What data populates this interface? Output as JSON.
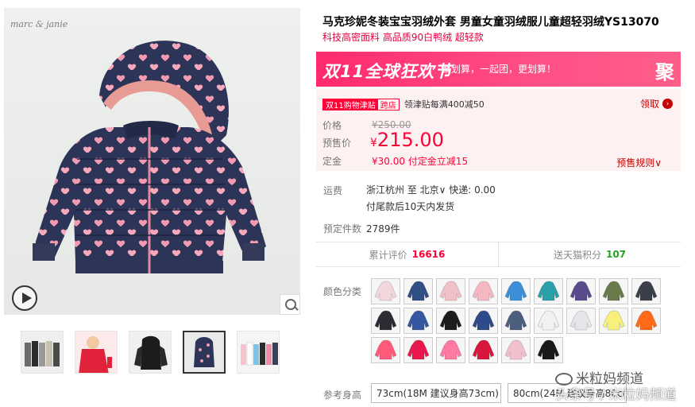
{
  "gallery": {
    "brand_logo": "marc & janie",
    "play_icon": "play-icon",
    "zoom_icon": "zoom-icon",
    "thumbnails": [
      "thumb-1",
      "thumb-2",
      "thumb-3",
      "thumb-4",
      "thumb-5"
    ],
    "active_thumbnail": 4
  },
  "product": {
    "title": "马克珍妮冬装宝宝羽绒外套 男童女童羽绒服儿童超轻羽绒YS13070",
    "subtitle": "科技高密面料 高品质90白鸭绒 超轻款"
  },
  "banner": {
    "main": "双11全球狂欢节",
    "sub": "聚划算，一起团，更划算！",
    "right": "聚"
  },
  "promo": {
    "badge_left": "双11购物津贴",
    "badge_right": "跨店",
    "text": "领津贴每满400减50",
    "get_label": "领取"
  },
  "price": {
    "price_label": "价格",
    "original": "¥250.00",
    "presale_label": "预售价",
    "currency": "¥",
    "presale": "215.00",
    "deposit_label": "定金",
    "deposit": "¥30.00  付定金立减15",
    "rules": "预售规则∨"
  },
  "shipping": {
    "label": "运费",
    "value": "浙江杭州  至  北京∨  快递: 0.00",
    "note": "付尾款后10天内发货"
  },
  "presale_count": {
    "label": "预定件数",
    "value": "2789件"
  },
  "stats": {
    "reviews_label": "累计评价",
    "reviews_value": "16616",
    "points_label": "送天猫积分",
    "points_value": "107"
  },
  "colors": {
    "label": "颜色分类",
    "swatches": [
      "#f3d7dc",
      "#2f4f86",
      "#f0c2c8",
      "#f5b8c2",
      "#3c8fd6",
      "#2aa0a8",
      "#5a4c8a",
      "#6a7a4a",
      "#3b3f4a",
      "#2c2c34",
      "#3556a0",
      "#1d1d1f",
      "#2e4a8a",
      "#4c5f7c",
      "#f1f1f1",
      "#e6e6ea",
      "#f7f07a",
      "#ff6a1a",
      "#ff5a7a",
      "#e8184e",
      "#ff7aa0",
      "#d8183a",
      "#f0c0cc",
      "#1a1a1a"
    ]
  },
  "sizes": {
    "label": "参考身高",
    "option1": "73cm(18M 建议身高73cm)",
    "option2": "80cm(24M 建议身高80cm)"
  },
  "watermark": {
    "line1": "米粒妈频道",
    "line2": "头条号 / 米粒妈频道"
  }
}
